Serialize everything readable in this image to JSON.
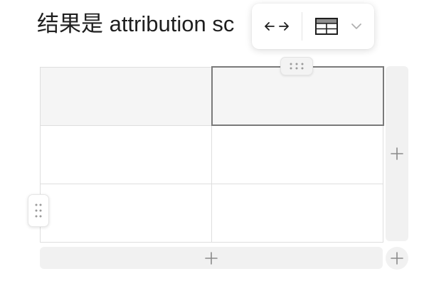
{
  "document": {
    "heading_text": "结果是 attribution sc"
  },
  "toolbar": {
    "resize_icon": "horizontal-resize-icon",
    "layout_icon": "table-layout-icon",
    "dropdown_icon": "chevron-down-icon"
  },
  "table": {
    "rows": 3,
    "columns": 2,
    "header_row": true,
    "selected_cell": {
      "row": 1,
      "column": 2
    },
    "cells": [
      [
        "",
        ""
      ],
      [
        "",
        ""
      ],
      [
        "",
        ""
      ]
    ]
  },
  "controls": {
    "column_handle_icon": "drag-handle-horizontal-icon",
    "row_handle_icon": "drag-handle-vertical-icon",
    "add_column_icon": "plus-icon",
    "add_row_icon": "plus-icon",
    "add_row_column_icon": "plus-icon"
  },
  "colors": {
    "text": "#1f1f1f",
    "header_fill": "#f5f5f5",
    "grid_line": "#dedede",
    "selected_border": "#7a7a7a",
    "control_fill": "#f1f1f1",
    "icon": "#8a8a8a"
  }
}
